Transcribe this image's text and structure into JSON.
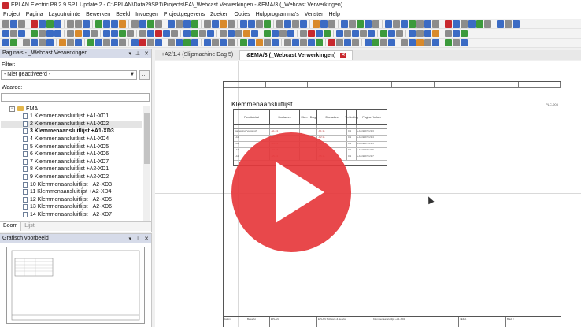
{
  "window": {
    "title": "EPLAN Electric P8 2.9 SP1 Update 2 - C:\\EPLAN\\Data29SP1\\Projects\\EA\\_Webcast Verwerkingen - &EMA/3 (_Webcast Verwerkingen)"
  },
  "menu": [
    "Project",
    "Pagina",
    "Layoutruimte",
    "Bewerken",
    "Beeld",
    "Invoegen",
    "Projectgegevens",
    "Zoeken",
    "Opties",
    "Hulpprogramma's",
    "Venster",
    "Help"
  ],
  "toolbar_colors": {
    "blue": "#3b6bc4",
    "green": "#3c9a3c",
    "red": "#c8282e",
    "gray": "#8c8c8c",
    "orange": "#d98a2b"
  },
  "pages_panel": {
    "title": "Pagina's - _Webcast Verwerkingen",
    "filter_label": "Filter:",
    "filter_value": "- Niet geactiveerd -",
    "filter_button": "...",
    "value_label": "Waarde:",
    "tree_root": "EMA",
    "tree_items": [
      "1 Klemmenaansluitlijst +A1-XD1",
      "2 Klemmenaansluitlijst +A1-XD2",
      "3 Klemmenaansluitlijst +A1-XD3",
      "4 Klemmenaansluitlijst +A1-XD4",
      "5 Klemmenaansluitlijst +A1-XD5",
      "6 Klemmenaansluitlijst +A1-XD6",
      "7 Klemmenaansluitlijst +A1-XD7",
      "8 Klemmenaansluitlijst +A2-XD1",
      "9 Klemmenaansluitlijst +A2-XD2",
      "10 Klemmenaansluitlijst +A2-XD3",
      "11 Klemmenaansluitlijst +A2-XD4",
      "12 Klemmenaansluitlijst +A2-XD5",
      "13 Klemmenaansluitlijst +A2-XD6",
      "14 Klemmenaansluitlijst +A2-XD7"
    ],
    "tabs": [
      "Boom",
      "Lijst"
    ]
  },
  "preview_panel": {
    "title": "Grafisch voorbeeld"
  },
  "doc_tabs": [
    "+A2/1.4 (Slijpmachine Dag 5)",
    "&EMA/3 (_Webcast Verwerkingen)"
  ],
  "document": {
    "heading": "Klemmenaansluitlijst",
    "corner": "PLC-003",
    "column_headers": [
      "Functietekst",
      "Doeladres",
      "Klem",
      "Brug",
      "Doeladres",
      "Verbinding",
      "Pagina / kolom"
    ],
    "rows": [
      [
        "Aanleiding \"verstand\"",
        "-S1-X1",
        "",
        "",
        "-K1:11",
        "0.1",
        "+A1/&EFS1/1.3"
      ],
      [
        "+A1",
        "-S2-X1",
        "",
        "",
        "-K2:11",
        "0.1",
        "+A1/&EFS1/1.4"
      ],
      [
        "+A1",
        "-S3-X1",
        "",
        "",
        "-K3:11",
        "0.1",
        "+A1/&EFS1/1.5"
      ],
      [
        "+A1",
        "-S4-X1",
        "",
        "",
        "-K4:11",
        "0.1",
        "+A1/&EFS1/1.6"
      ],
      [
        "+A1",
        "-S5-X1",
        "",
        "",
        "-K5:11",
        "0.1",
        "+A1/&EFS1/1.7"
      ]
    ],
    "title_block": [
      "Datum",
      "Bewerkt",
      "EPLAN",
      "EPLAN Software & Service",
      "Klemmenaansluitlijst +A1-XD3",
      "=EMA",
      "Blad 3"
    ]
  }
}
